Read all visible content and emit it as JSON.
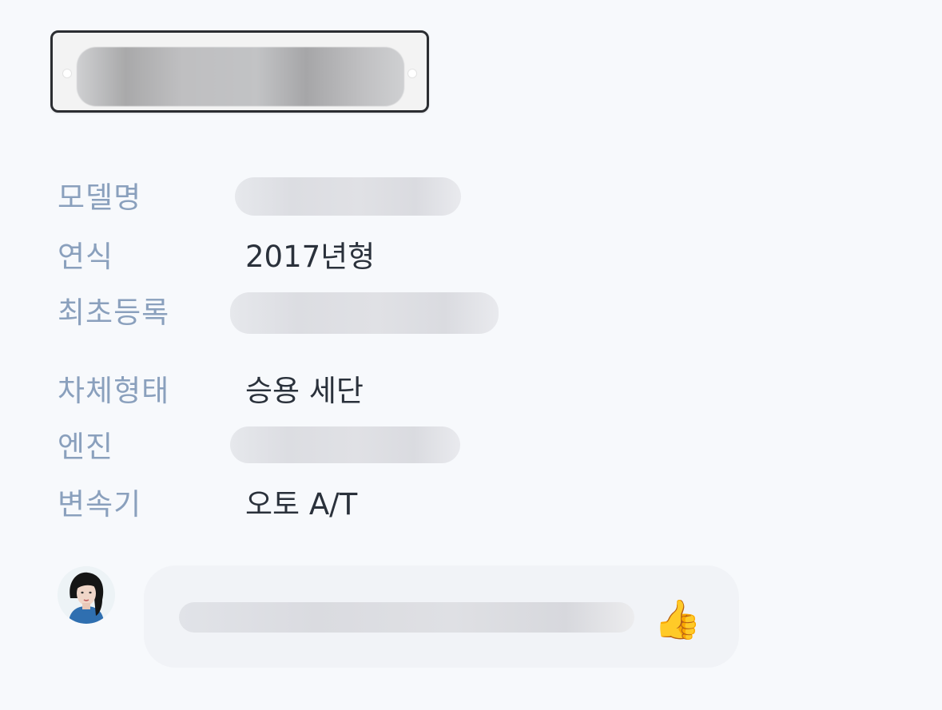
{
  "plate": {
    "number": ""
  },
  "specs": [
    {
      "label": "모델명",
      "value": ""
    },
    {
      "label": "연식",
      "value": "2017년형"
    },
    {
      "label": "최초등록",
      "value": ""
    },
    {
      "label": "차체형태",
      "value": "승용 세단"
    },
    {
      "label": "엔진",
      "value": ""
    },
    {
      "label": "변속기",
      "value": "오토 A/T"
    }
  ],
  "chat": {
    "message": "",
    "emoji": "👍"
  }
}
